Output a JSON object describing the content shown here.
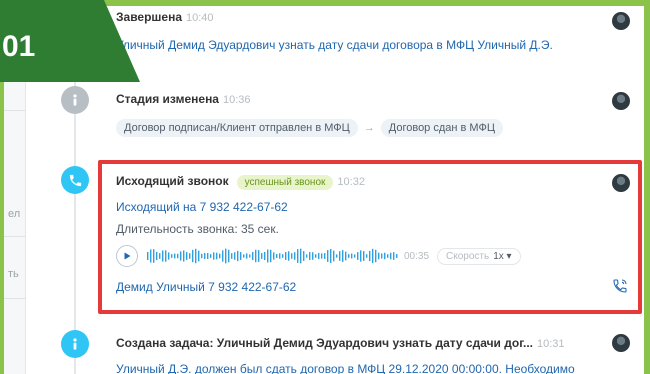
{
  "badge": {
    "number": "01",
    "color": "#2e7d32"
  },
  "left_strip": {
    "text_1": "ел",
    "text_2": "ть"
  },
  "events": {
    "completed": {
      "title": "Завершена",
      "time": "10:40",
      "text": "Уличный Демид Эдуардович узнать дату сдачи договора в МФЦ Уличный Д.Э."
    },
    "stage": {
      "title": "Стадия изменена",
      "time": "10:36",
      "from": "Договор подписан/Клиент отправлен в МФЦ",
      "arrow": "→",
      "to": "Договор сдан в МФЦ",
      "icon": "info-icon"
    },
    "call": {
      "title": "Исходящий звонок",
      "status": "успешный звонок",
      "time": "10:32",
      "number_link": "Исходящий на 7 932 422-67-62",
      "duration_text": "Длительность звонка: 35 сек.",
      "player_time": "00:35",
      "speed_label": "Скорость",
      "speed_value": "1x ▾",
      "contact": "Демид Уличный 7 932 422-67-62",
      "icon": "phone-icon"
    },
    "task": {
      "title": "Создана задача: Уличный Демид Эдуардович узнать дату сдачи дог...",
      "time": "10:31",
      "text": "Уличный Д.Э. должен был сдать договор в МФЦ 29.12.2020 00:00:00. Необходимо",
      "icon": "info-icon"
    }
  },
  "colors": {
    "accent_green": "#8bc34a",
    "highlight_red": "#e43a3a",
    "link_blue": "#2067b0",
    "call_cyan": "#2fc6f6"
  }
}
